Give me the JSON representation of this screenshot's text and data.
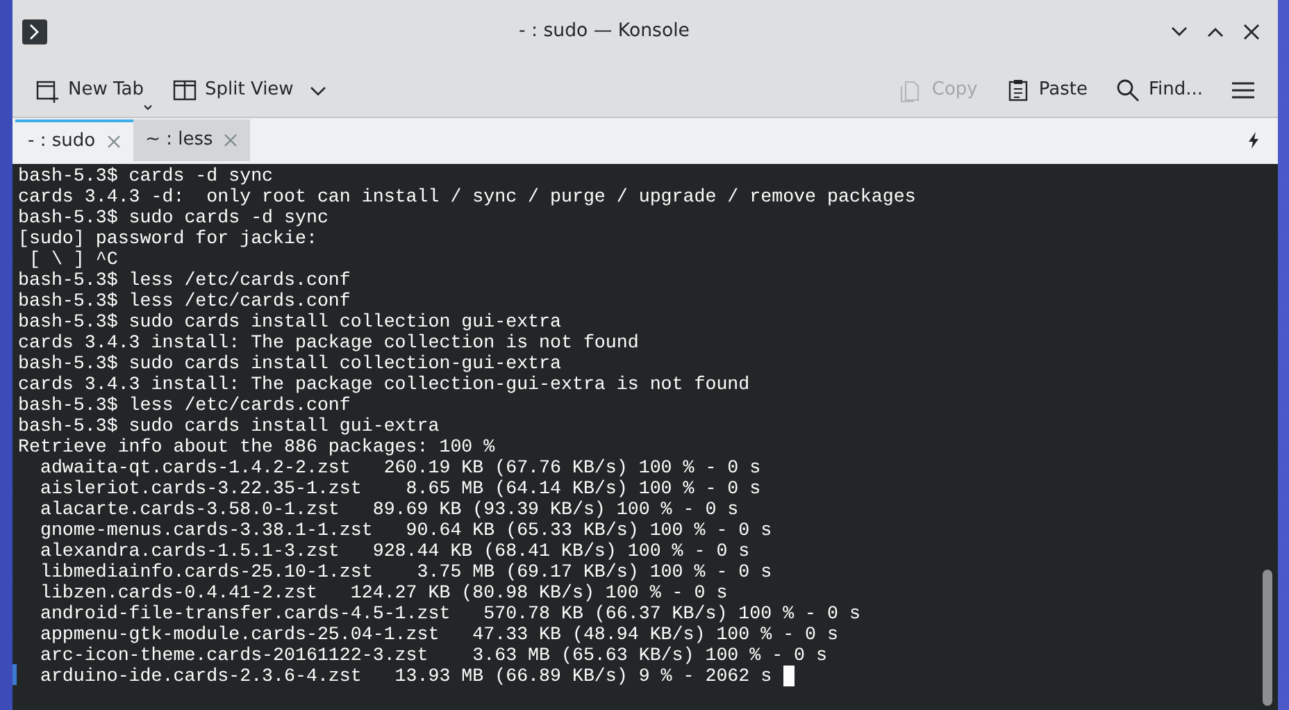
{
  "window": {
    "title": "- : sudo — Konsole"
  },
  "toolbar": {
    "buttons": [
      {
        "kind": "new-tab",
        "label": "New Tab",
        "disabled": false
      },
      {
        "kind": "split-view",
        "label": "Split View",
        "disabled": false
      },
      {
        "kind": "copy",
        "label": "Copy",
        "disabled": true
      },
      {
        "kind": "paste",
        "label": "Paste",
        "disabled": false
      },
      {
        "kind": "find",
        "label": "Find...",
        "disabled": false
      }
    ]
  },
  "tabs": [
    {
      "label": "- : sudo",
      "selected": true
    },
    {
      "label": "~ : less",
      "selected": false
    }
  ],
  "terminal": {
    "lines": [
      "bash-5.3$ cards -d sync",
      "cards 3.4.3 -d:  only root can install / sync / purge / upgrade / remove packages",
      "bash-5.3$ sudo cards -d sync",
      "[sudo] password for jackie:",
      " [ \\ ] ^C",
      "bash-5.3$ less /etc/cards.conf",
      "bash-5.3$ less /etc/cards.conf",
      "bash-5.3$ sudo cards install collection gui-extra",
      "cards 3.4.3 install: The package collection is not found",
      "bash-5.3$ sudo cards install collection-gui-extra",
      "cards 3.4.3 install: The package collection-gui-extra is not found",
      "bash-5.3$ less /etc/cards.conf",
      "bash-5.3$ sudo cards install gui-extra",
      "Retrieve info about the 886 packages: 100 %",
      "  adwaita-qt.cards-1.4.2-2.zst   260.19 KB (67.76 KB/s) 100 % - 0 s",
      "  aisleriot.cards-3.22.35-1.zst    8.65 MB (64.14 KB/s) 100 % - 0 s",
      "  alacarte.cards-3.58.0-1.zst   89.69 KB (93.39 KB/s) 100 % - 0 s",
      "  gnome-menus.cards-3.38.1-1.zst   90.64 KB (65.33 KB/s) 100 % - 0 s",
      "  alexandra.cards-1.5.1-3.zst   928.44 KB (68.41 KB/s) 100 % - 0 s",
      "  libmediainfo.cards-25.10-1.zst    3.75 MB (69.17 KB/s) 100 % - 0 s",
      "  libzen.cards-0.4.41-2.zst   124.27 KB (80.98 KB/s) 100 % - 0 s",
      "  android-file-transfer.cards-4.5-1.zst   570.78 KB (66.37 KB/s) 100 % - 0 s",
      "  appmenu-gtk-module.cards-25.04-1.zst   47.33 KB (48.94 KB/s) 100 % - 0 s",
      "  arc-icon-theme.cards-20161122-3.zst    3.63 MB (65.63 KB/s) 100 % - 0 s",
      "  arduino-ide.cards-2.3.6-4.zst   13.93 MB (66.89 KB/s) 9 % - 2062 s"
    ]
  }
}
